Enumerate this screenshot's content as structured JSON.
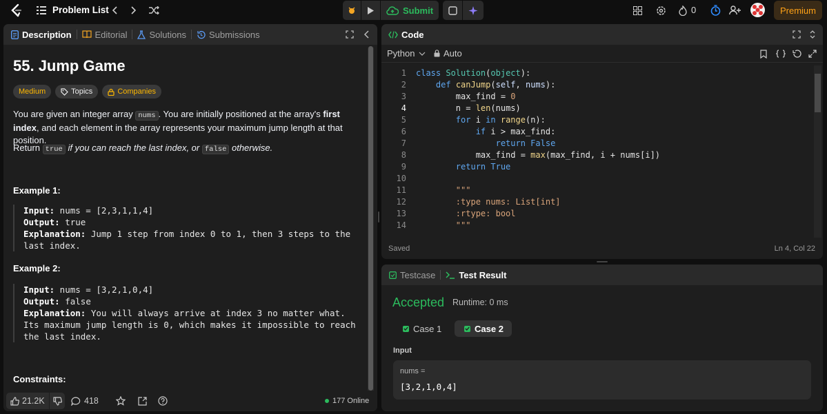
{
  "topbar": {
    "problem_list": "Problem List",
    "submit": "Submit",
    "streak_count": "0",
    "premium": "Premium"
  },
  "left": {
    "tabs": [
      "Description",
      "Editorial",
      "Solutions",
      "Submissions"
    ],
    "title": "55. Jump Game",
    "difficulty": "Medium",
    "topics": "Topics",
    "companies": "Companies",
    "p1_a": "You are given an integer array ",
    "p1_code": "nums",
    "p1_b": ". You are initially positioned at the array's ",
    "p1_bold": "first index",
    "p1_c": ", and each element in the array represents your maximum jump length at that position.",
    "p2_a": "Return ",
    "p2_code1": "true",
    "p2_b": " if you can reach the last index, or ",
    "p2_code2": "false",
    "p2_c": " otherwise.",
    "example1_title": "Example 1:",
    "example1": {
      "input_label": "Input:",
      "input": " nums = [2,3,1,1,4]",
      "output_label": "Output:",
      "output": " true",
      "expl_label": "Explanation:",
      "expl": " Jump 1 step from index 0 to 1, then 3 steps to the last index."
    },
    "example2_title": "Example 2:",
    "example2": {
      "input_label": "Input:",
      "input": " nums = [3,2,1,0,4]",
      "output_label": "Output:",
      "output": " false",
      "expl_label": "Explanation:",
      "expl": " You will always arrive at index 3 no matter what. Its maximum jump length is 0, which makes it impossible to reach the last index."
    },
    "constraints_title": "Constraints:",
    "likes": "21.2K",
    "comments": "418",
    "online": "177 Online"
  },
  "code": {
    "title": "Code",
    "language": "Python",
    "auto": "Auto",
    "saved": "Saved",
    "cursor": "Ln 4, Col 22",
    "line_numbers": [
      "1",
      "2",
      "3",
      "4",
      "5",
      "6",
      "7",
      "8",
      "9",
      "10",
      "11",
      "12",
      "13",
      "14"
    ]
  },
  "result": {
    "tab_testcase": "Testcase",
    "tab_result": "Test Result",
    "status": "Accepted",
    "runtime": "Runtime: 0 ms",
    "cases": [
      "Case 1",
      "Case 2"
    ],
    "input_label": "Input",
    "var_name": "nums =",
    "var_value": "[3,2,1,0,4]"
  },
  "colors": {
    "accepted": "#2cbb5d",
    "submit": "#2cbb5d",
    "premium": "#ffa116",
    "medium": "#ffb800"
  }
}
